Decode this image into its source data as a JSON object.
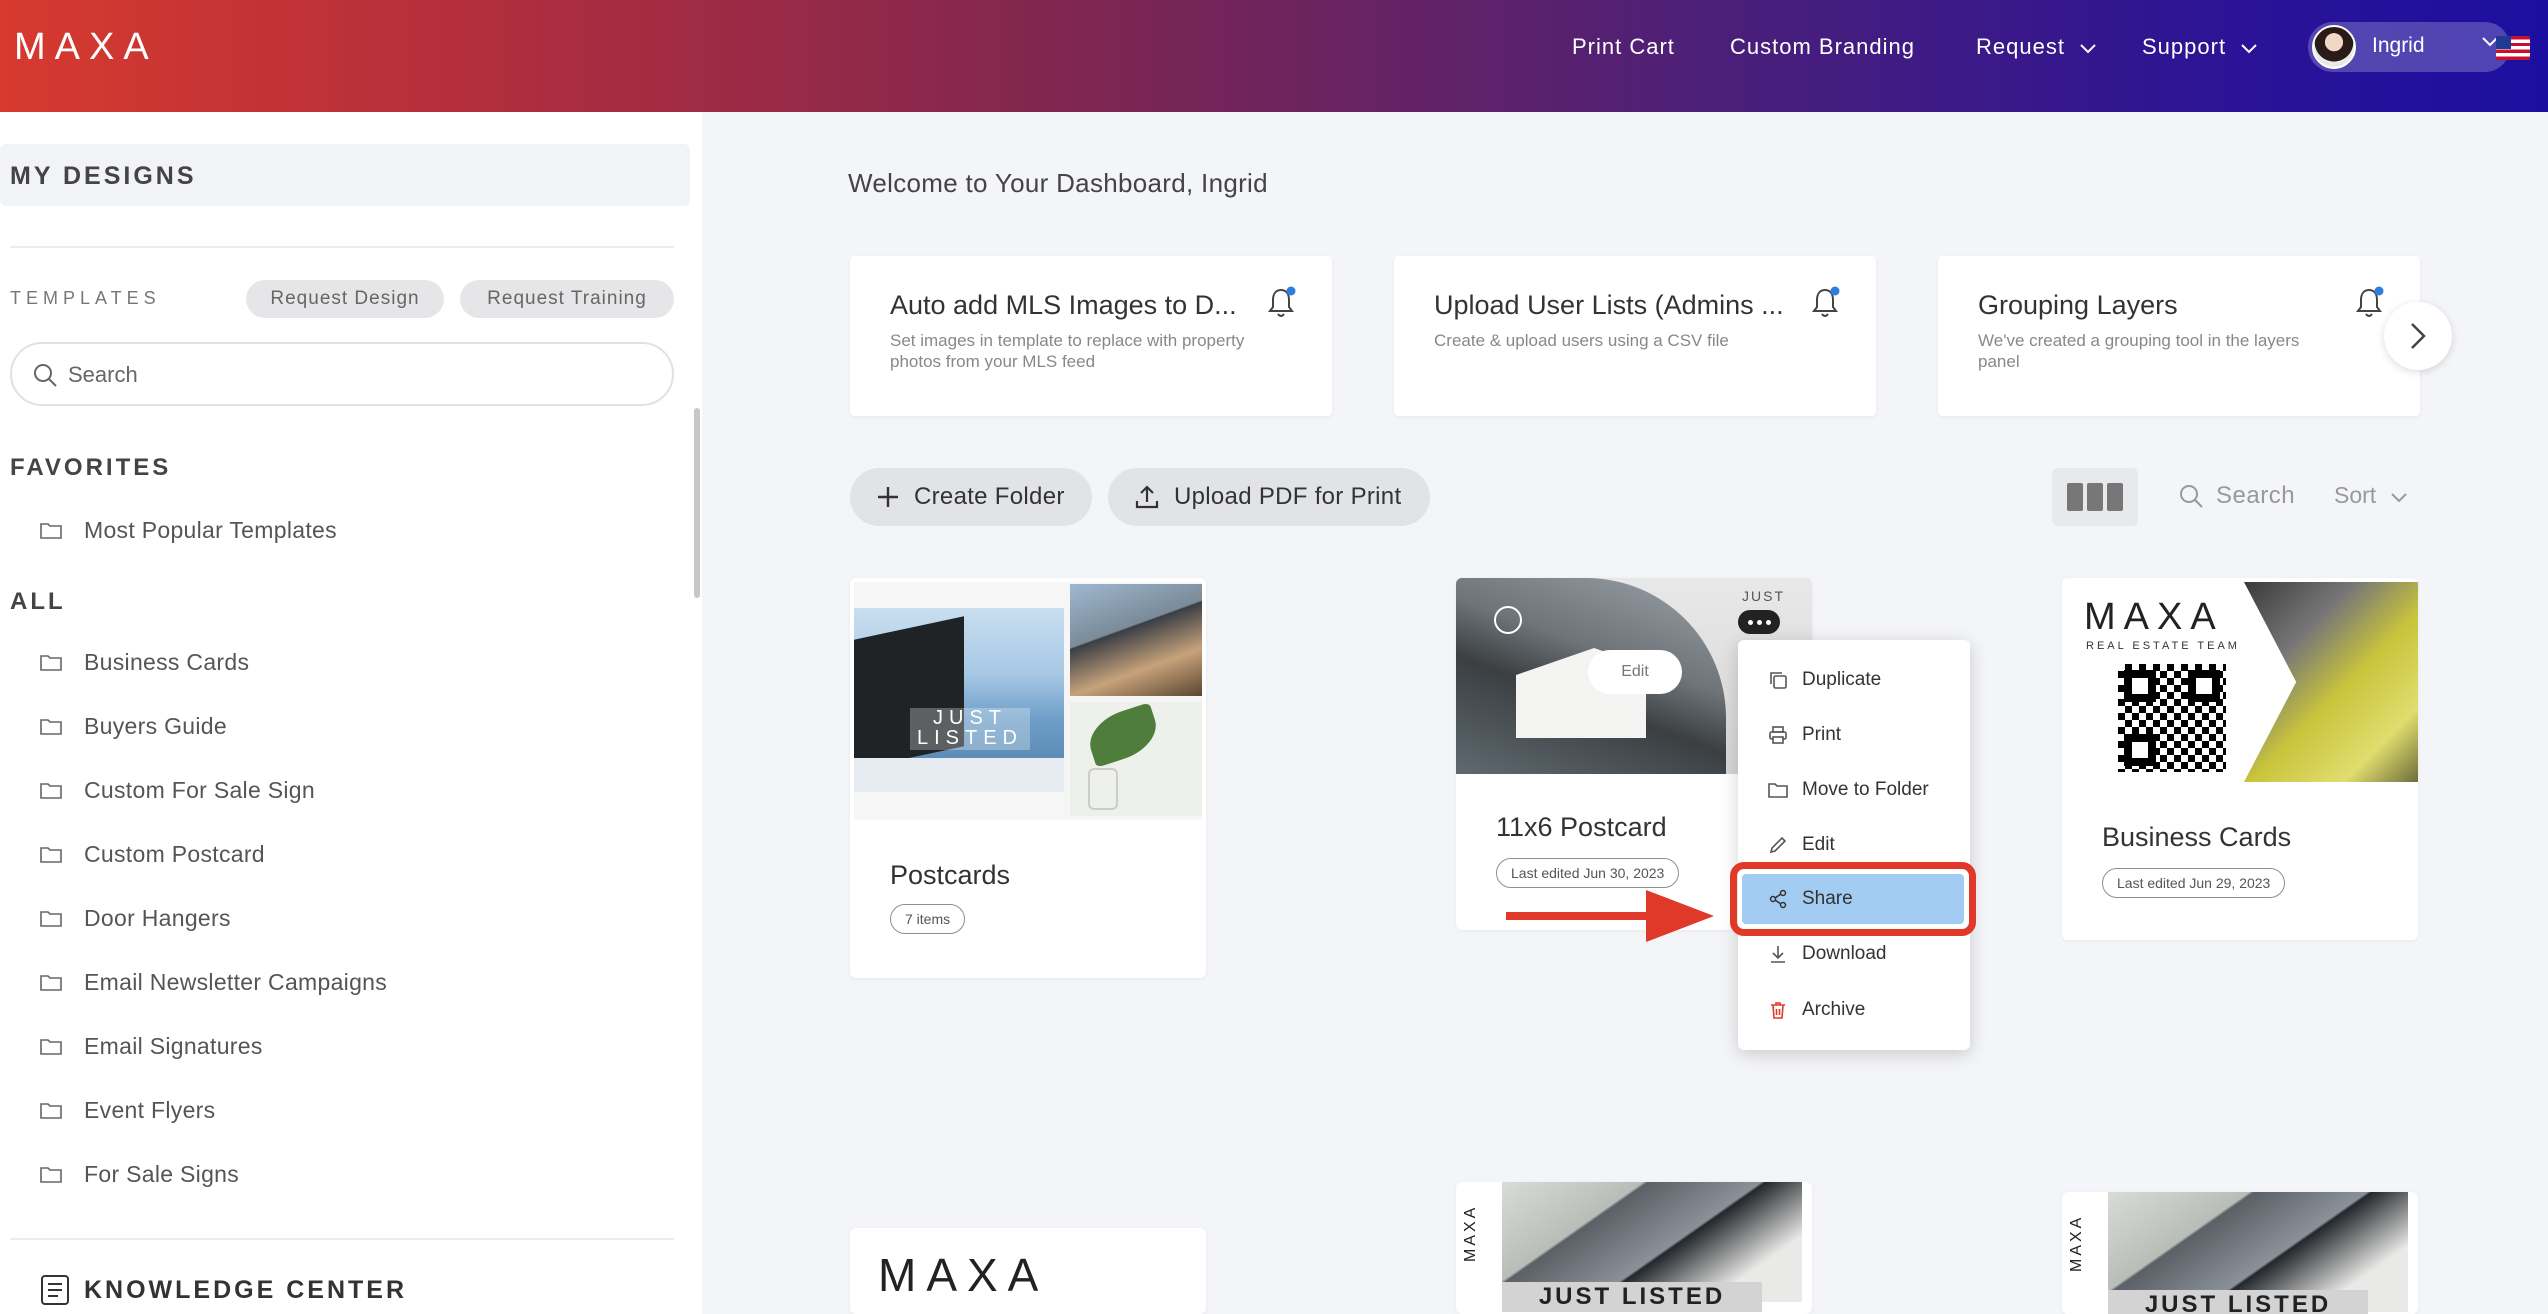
{
  "header": {
    "logo": "MAXA",
    "nav": {
      "print_cart": "Print Cart",
      "custom_branding": "Custom Branding",
      "request": "Request",
      "support": "Support"
    },
    "user_name": "Ingrid",
    "flag": "us-flag-icon"
  },
  "sidebar": {
    "my_designs": "MY DESIGNS",
    "templates_label": "TEMPLATES",
    "request_design": "Request Design",
    "request_training": "Request Training",
    "search_placeholder": "Search",
    "favorites_heading": "FAVORITES",
    "favorites": [
      "Most Popular Templates"
    ],
    "all_heading": "ALL",
    "all_items": [
      "Business Cards",
      "Buyers Guide",
      "Custom For Sale Sign",
      "Custom Postcard",
      "Door Hangers",
      "Email Newsletter Campaigns",
      "Email Signatures",
      "Event Flyers",
      "For Sale Signs"
    ],
    "knowledge_center": "KNOWLEDGE CENTER"
  },
  "main": {
    "welcome": "Welcome to Your Dashboard, Ingrid",
    "features": [
      {
        "title": "Auto add MLS Images to D...",
        "desc": "Set images in template to replace with property photos from your MLS feed"
      },
      {
        "title": "Upload User Lists (Admins ...",
        "desc": "Create & upload users using a CSV file"
      },
      {
        "title": "Grouping Layers",
        "desc": "We've created a grouping tool in the layers panel"
      }
    ],
    "create_folder": "Create Folder",
    "upload_pdf": "Upload PDF for Print",
    "search": "Search",
    "sort": "Sort",
    "cards": [
      {
        "title": "Postcards",
        "tag": "7 items",
        "thumb_text": "JUST LISTED"
      },
      {
        "title": "11x6 Postcard",
        "tag": "Last edited Jun 30, 2023",
        "edit": "Edit",
        "thumb_text": "JUST"
      },
      {
        "title": "Business Cards",
        "tag": "Last edited Jun 29, 2023",
        "thumb_logo": "MAXA",
        "thumb_sub": "REAL ESTATE TEAM"
      }
    ],
    "bottom_cards": [
      {
        "logo": "MAXA"
      },
      {
        "band": "JUST LISTED",
        "vertical": "MAXA"
      },
      {
        "band": "JUST LISTED",
        "vertical": "MAXA"
      }
    ]
  },
  "context_menu": {
    "items": [
      "Duplicate",
      "Print",
      "Move to Folder",
      "Edit",
      "Share",
      "Download",
      "Archive"
    ],
    "highlighted": "Share"
  },
  "colors": {
    "highlight_border": "#e0392a",
    "share_fill": "#a3ccf2",
    "accent_blue": "#2f7de1"
  }
}
